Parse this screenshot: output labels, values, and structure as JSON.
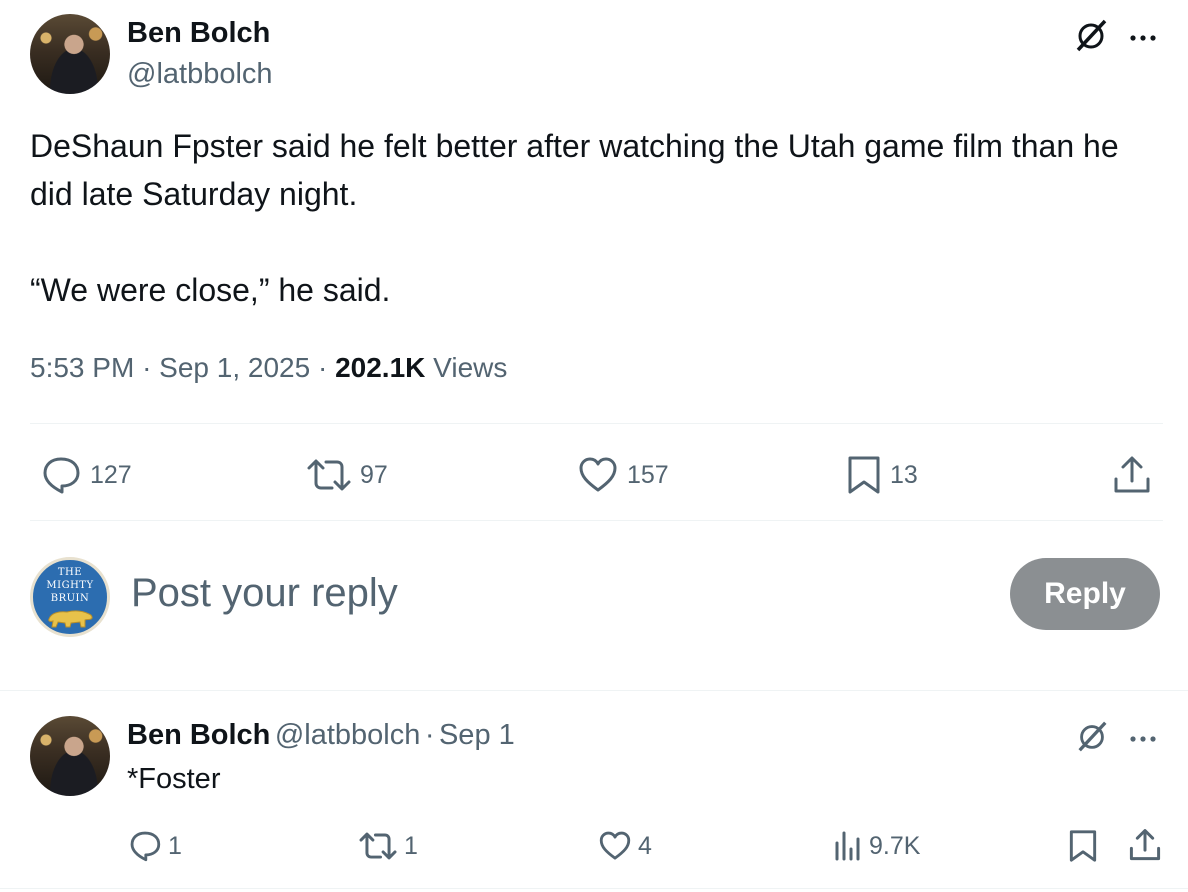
{
  "post": {
    "author_name": "Ben Bolch",
    "author_handle": "@latbbolch",
    "text": "DeShaun Fpster said he felt better after watching the Utah game film than he did late Saturday night.\n\n“We were close,” he said.",
    "time": "5:53 PM",
    "date": "Sep 1, 2025",
    "views_count": "202.1K",
    "views_label": "Views",
    "separator": "·",
    "stats": {
      "replies": "127",
      "reposts": "97",
      "likes": "157",
      "bookmarks": "13"
    }
  },
  "compose": {
    "avatar_text": "The Mighty Bruin",
    "avatar_line1": "THE",
    "avatar_line2": "MIGHTY",
    "avatar_line3": "BRUIN",
    "placeholder": "Post your reply",
    "reply_button": "Reply"
  },
  "reply": {
    "author_name": "Ben Bolch",
    "author_handle": "@latbbolch",
    "separator": "·",
    "date": "Sep 1",
    "text": "*Foster",
    "stats": {
      "replies": "1",
      "reposts": "1",
      "likes": "4",
      "views": "9.7K"
    }
  },
  "colors": {
    "text_primary": "#0f1419",
    "text_secondary": "#536471",
    "divider": "#eff3f4",
    "reply_button_disabled": "#8b8f92",
    "bruin_blue": "#2c6db0"
  },
  "icons": [
    "grok-icon",
    "more-icon",
    "reply-icon",
    "repost-icon",
    "like-icon",
    "bookmark-icon",
    "share-icon",
    "views-icon"
  ]
}
